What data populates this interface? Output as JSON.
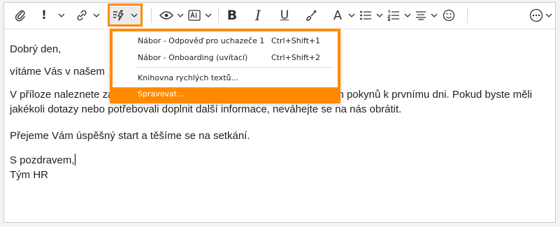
{
  "toolbar": {
    "buttons": [
      {
        "id": "attach",
        "icon": "paperclip-icon"
      },
      {
        "id": "importance",
        "icon": "exclamation-icon",
        "glyph": "!"
      },
      {
        "id": "link",
        "icon": "link-icon"
      },
      {
        "id": "quick-parts",
        "icon": "quick-text-icon"
      },
      {
        "id": "view",
        "icon": "eye-icon"
      },
      {
        "id": "textbox",
        "icon": "text-box-icon"
      },
      {
        "id": "bold",
        "glyph": "B"
      },
      {
        "id": "italic",
        "glyph": "I"
      },
      {
        "id": "underline",
        "glyph": "U"
      },
      {
        "id": "format-painter",
        "icon": "paintbrush-icon"
      },
      {
        "id": "font-color",
        "glyph": "A"
      },
      {
        "id": "bullets",
        "icon": "bullet-list-icon"
      },
      {
        "id": "numbering",
        "icon": "numbered-list-icon"
      },
      {
        "id": "align",
        "icon": "align-icon"
      },
      {
        "id": "emoji",
        "icon": "smiley-icon"
      },
      {
        "id": "more",
        "icon": "more-icon"
      }
    ]
  },
  "email": {
    "greeting": "Dobrý den,",
    "line2": "vítáme Vás v našem",
    "paragraph": "V příloze naleznete základní informace k nástupu, včetně organizačních pokynů k prvnímu dni. Pokud byste měli jakékoli dotazy nebo potřebovali doplnit další informace, neváhejte se na nás obrátit.",
    "wish": "Přejeme Vám úspěšný start a těšíme se na setkání.",
    "closing": "S pozdravem,",
    "signature": "Tým HR"
  },
  "menu": {
    "items": [
      {
        "label": "Nábor - Odpověď pro uchazeče 1",
        "shortcut": "Ctrl+Shift+1"
      },
      {
        "label": "Nábor - Onboarding (uvítací)",
        "shortcut": "Ctrl+Shift+2"
      },
      {
        "label": "Knihovna rychlých textů..."
      },
      {
        "label": "Spravovat..."
      }
    ]
  },
  "colors": {
    "accent": "#ff8a00"
  }
}
